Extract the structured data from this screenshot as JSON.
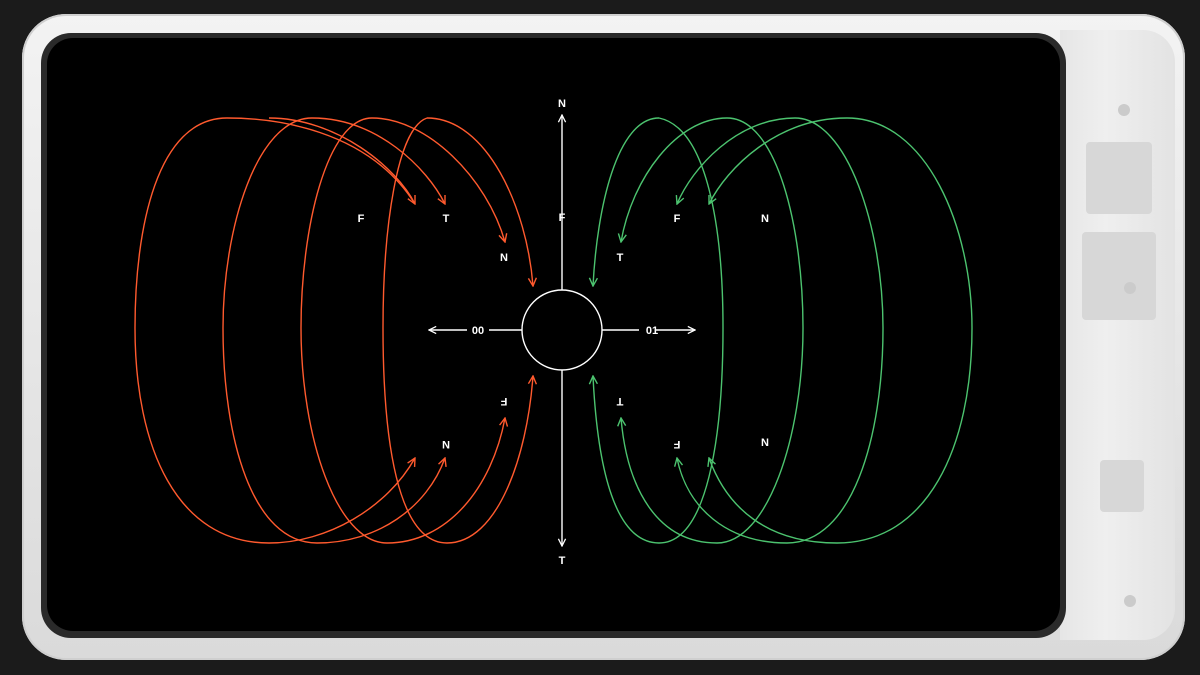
{
  "colors": {
    "left_field": "#ff5a2e",
    "right_field": "#4cc36f",
    "axis": "#ffffff",
    "background": "#000000"
  },
  "axis_labels": {
    "top": "N",
    "bottom": "T",
    "upper": "F",
    "left_value": "00",
    "right_value": "01"
  },
  "left_labels": {
    "upper_1": "F",
    "upper_2": "T",
    "upper_3": "N",
    "lower_1": "F",
    "lower_2": "N"
  },
  "right_labels": {
    "upper_1": "F",
    "upper_2": "N",
    "upper_3": "T",
    "lower_1": "T",
    "lower_2": "F",
    "lower_3": "N"
  },
  "icons": [
    "arrow-head-icon",
    "center-ring-icon"
  ]
}
